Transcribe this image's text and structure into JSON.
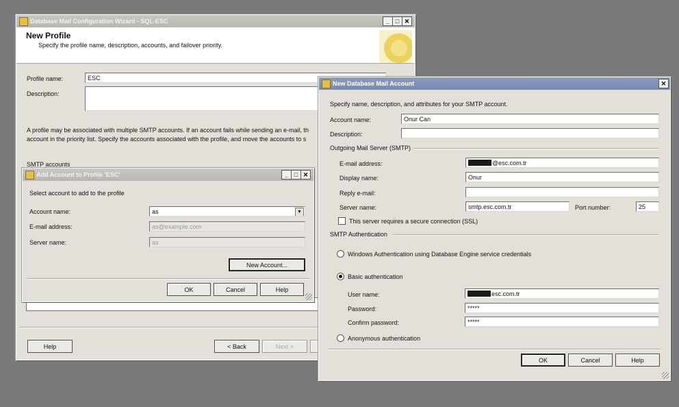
{
  "wizard": {
    "title": "Database Mail Configuration Wizard - SQL-ESC",
    "heading": "New Profile",
    "subheading": "Specify the profile name, description, accounts, and failover priority.",
    "profile_name_label": "Profile name:",
    "profile_name_value": "ESC",
    "description_label": "Description:",
    "info_line1": "A profile may be associated with multiple SMTP accounts. If an account fails while sending an e-mail, th",
    "info_line2": "account in the priority list. Specify the accounts associated with the profile, and move the accounts to s",
    "smtp_accounts_label": "SMTP accounts",
    "help_button": "Help",
    "back_button": "< Back",
    "next_button": "Next >"
  },
  "add_account": {
    "title": "Add Account to Profile 'ESC'",
    "instruction": "Select account to add to the profile",
    "account_name_label": "Account name:",
    "account_name_value": "as",
    "email_label": "E-mail address:",
    "email_value": "as@example.com",
    "server_label": "Server name:",
    "server_value": "as",
    "new_account_button": "New Account...",
    "ok_button": "OK",
    "cancel_button": "Cancel",
    "help_button": "Help"
  },
  "new_account": {
    "title": "New Database Mail Account",
    "instruction": "Specify name, description, and attributes for your SMTP account.",
    "account_name_label": "Account name:",
    "account_name_value": "Onur Can",
    "description_label": "Description:",
    "description_value": "",
    "outgoing_group": "Outgoing Mail Server (SMTP)",
    "email_label": "E-mail address:",
    "email_value": "@esc.com.tr",
    "display_name_label": "Display name:",
    "display_name_value": "Onur",
    "reply_label": "Reply e-mail:",
    "reply_value": "",
    "server_label": "Server name:",
    "server_value": "smtp.esc.com.tr",
    "port_label": "Port number:",
    "port_value": "25",
    "ssl_label": "This server requires a secure connection (SSL)",
    "auth_group": "SMTP Authentication",
    "windows_auth_label": "Windows Authentication using Database Engine service credentials",
    "basic_auth_label": "Basic authentication",
    "username_label": "User name:",
    "username_value": "esc.com.tr",
    "password_label": "Password:",
    "password_value": "*****",
    "confirm_label": "Confirm password:",
    "confirm_value": "*****",
    "anonymous_label": "Anonymous authentication",
    "ok_button": "OK",
    "cancel_button": "Cancel",
    "help_button": "Help"
  },
  "colors": {
    "desktop": "#7a7a7a",
    "window_face": "#e3e0d9",
    "active_title": "#8e9bbf"
  }
}
